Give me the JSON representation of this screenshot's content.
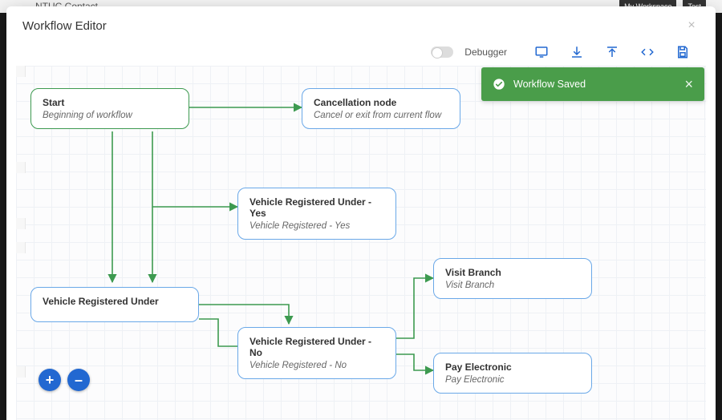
{
  "background": {
    "tab_peek": "NTUC Contact",
    "top_right_pills": [
      "My Workspace",
      "Test"
    ]
  },
  "modal": {
    "title": "Workflow Editor",
    "debugger_label": "Debugger",
    "debugger_on": false
  },
  "toast": {
    "message": "Workflow Saved"
  },
  "nodes": {
    "start": {
      "title": "Start",
      "subtitle": "Beginning of workflow"
    },
    "cancel": {
      "title": "Cancellation node",
      "subtitle": "Cancel or exit from current flow"
    },
    "vru": {
      "title": "Vehicle Registered Under",
      "subtitle": ""
    },
    "vru_yes": {
      "title": "Vehicle Registered Under - Yes",
      "subtitle": "Vehicle Registered - Yes"
    },
    "vru_no": {
      "title": "Vehicle Registered Under - No",
      "subtitle": "Vehicle Registered - No"
    },
    "visit": {
      "title": "Visit Branch",
      "subtitle": "Visit Branch"
    },
    "pay": {
      "title": "Pay Electronic",
      "subtitle": "Pay Electronic"
    }
  },
  "zoom": {
    "in": "+",
    "out": "–"
  }
}
